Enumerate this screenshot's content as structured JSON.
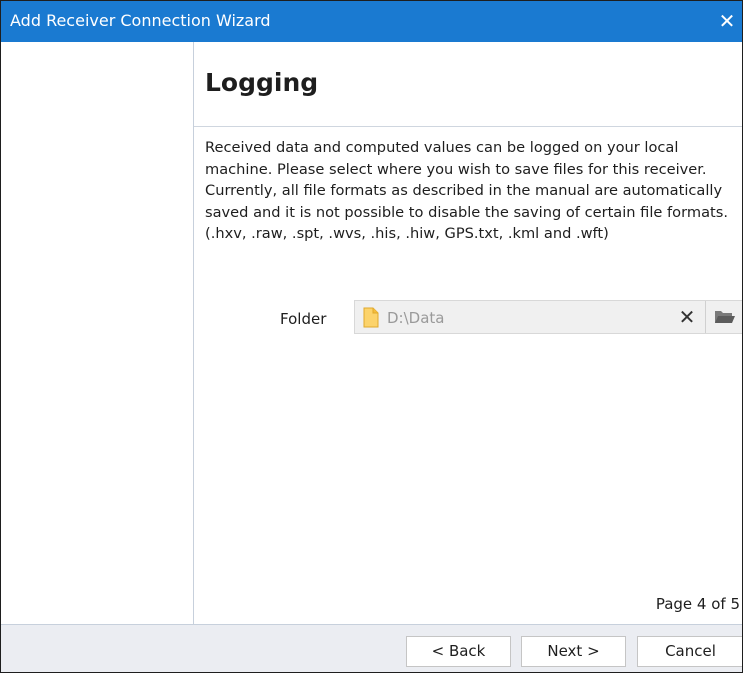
{
  "window": {
    "title": "Add Receiver Connection Wizard",
    "close_glyph": "✕",
    "accent_color": "#1a7ad1"
  },
  "page": {
    "title": "Logging",
    "description": "Received data and computed values can be logged on your local machine. Please select where you wish to save files for this receiver. Currently, all file formats as described in the manual are automatically saved and it is not possible to disable the saving of certain file formats. (.hxv, .raw, .spt, .wvs, .his, .hiw, GPS.txt, .kml and .wft)",
    "indicator": "Page 4 of 5"
  },
  "folder": {
    "label": "Folder",
    "value": "D:\\Data",
    "icon": "folder-icon",
    "clear_glyph": "✕",
    "browse_icon": "open-folder-icon"
  },
  "footer": {
    "back_label": "< Back",
    "next_label": "Next >",
    "cancel_label": "Cancel"
  }
}
